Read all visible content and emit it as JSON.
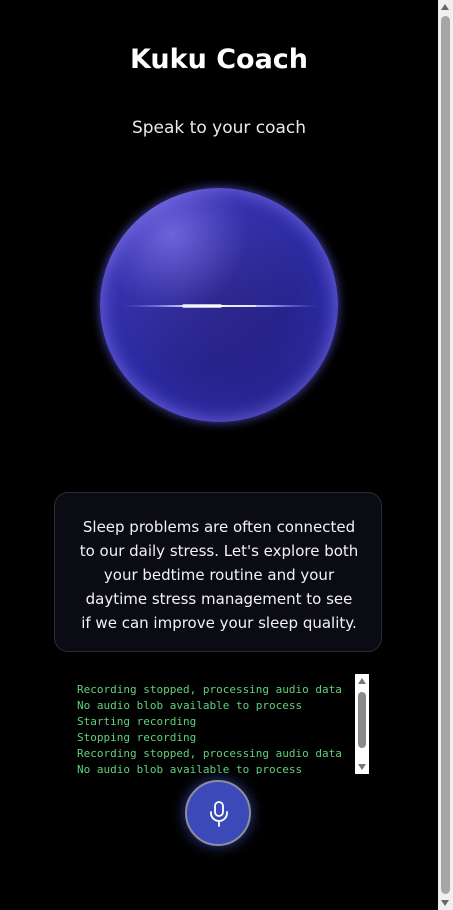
{
  "app": {
    "title": "Kuku Coach",
    "subtitle": "Speak to your coach"
  },
  "orb": {
    "icon": "voice-orb",
    "colors": {
      "core": "#1c1a6a",
      "rim": "#5a55e8",
      "glow": "#6e64ff"
    }
  },
  "message": {
    "text": "Sleep problems are often connected to our daily stress. Let's explore both your bedtime routine and your daytime stress management to see if we can improve your sleep quality."
  },
  "log": {
    "color": "#5fd07a",
    "lines": [
      "Recording stopped, processing audio data",
      "No audio blob available to process",
      "Starting recording",
      "Stopping recording",
      "Recording stopped, processing audio data",
      "No audio blob available to process"
    ]
  },
  "mic_button": {
    "icon": "microphone-icon",
    "color": "#3b4ab8"
  }
}
